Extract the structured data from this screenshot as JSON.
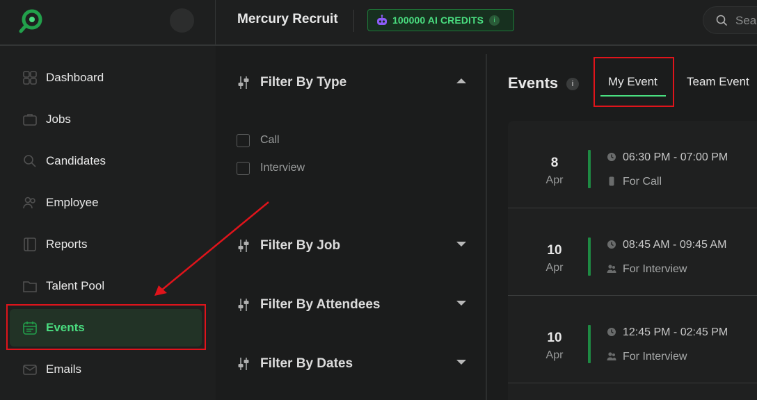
{
  "header": {
    "app_title": "Mercury Recruit",
    "credits_text": "100000 AI CREDITS",
    "credits_info": "i",
    "search_placeholder": "Search"
  },
  "sidebar": {
    "items": [
      {
        "label": "Dashboard",
        "icon": "dashboard-icon",
        "active": false
      },
      {
        "label": "Jobs",
        "icon": "briefcase-icon",
        "active": false
      },
      {
        "label": "Candidates",
        "icon": "search-user-icon",
        "active": false
      },
      {
        "label": "Employee",
        "icon": "users-icon",
        "active": false
      },
      {
        "label": "Reports",
        "icon": "report-icon",
        "active": false
      },
      {
        "label": "Talent Pool",
        "icon": "folder-icon",
        "active": false
      },
      {
        "label": "Events",
        "icon": "calendar-icon",
        "active": true
      },
      {
        "label": "Emails",
        "icon": "mail-icon",
        "active": false
      }
    ]
  },
  "filters": {
    "by_type": {
      "title": "Filter By Type",
      "expanded": true,
      "options": [
        "Call",
        "Interview"
      ]
    },
    "by_job": {
      "title": "Filter By Job",
      "expanded": false
    },
    "by_attendees": {
      "title": "Filter By Attendees",
      "expanded": false
    },
    "by_dates": {
      "title": "Filter By Dates",
      "expanded": false
    }
  },
  "events": {
    "title": "Events",
    "info": "i",
    "tabs": [
      {
        "label": "My Event",
        "active": true
      },
      {
        "label": "Team Event",
        "active": false
      }
    ],
    "items": [
      {
        "day": "8",
        "month": "Apr",
        "time": "06:30 PM - 07:00 PM",
        "type": "For Call",
        "type_icon": "phone-icon"
      },
      {
        "day": "10",
        "month": "Apr",
        "time": "08:45 AM - 09:45 AM",
        "type": "For Interview",
        "type_icon": "users-icon"
      },
      {
        "day": "10",
        "month": "Apr",
        "time": "12:45 PM - 02:45 PM",
        "type": "For Interview",
        "type_icon": "users-icon"
      }
    ]
  },
  "colors": {
    "accent": "#4ade80",
    "annotation": "#e0141b",
    "background": "#1b1c1c"
  }
}
